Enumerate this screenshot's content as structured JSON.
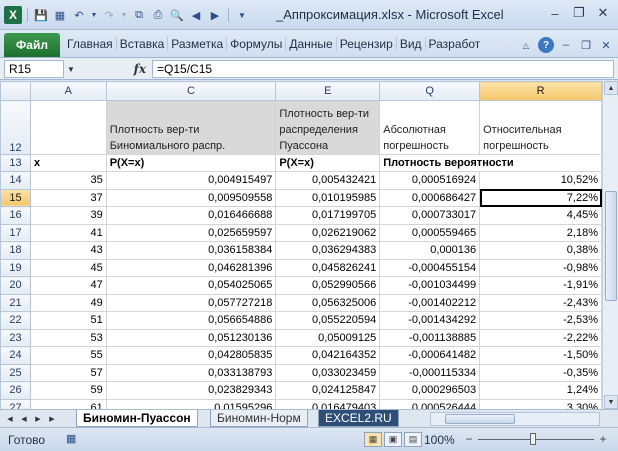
{
  "window": {
    "title": "_Аппроксимация.xlsx - Microsoft Excel"
  },
  "ribbon": {
    "file_tab": "Файл",
    "tabs": [
      "Главная",
      "Вставка",
      "Разметка",
      "Формулы",
      "Данные",
      "Рецензир",
      "Вид",
      "Разработ"
    ]
  },
  "formula_bar": {
    "name_box": "R15",
    "fx_label": "fx",
    "formula": "=Q15/C15"
  },
  "columns": {
    "A": "A",
    "C": "C",
    "E": "E",
    "Q": "Q",
    "R": "R"
  },
  "headers": {
    "row_number": "12",
    "c": "Плотность вер-ти Биномиального распр.",
    "e": "Плотность вер-ти распределения Пуассона",
    "q": "Абсолютная погрешность",
    "r": "Относительная погрешность"
  },
  "subheaders": {
    "row_number": "13",
    "a": "x",
    "c": "P(X=x)",
    "e": "P(X=x)",
    "q": "Плотность вероятности"
  },
  "rows": [
    {
      "n": "14",
      "a": "35",
      "c": "0,004915497",
      "e": "0,005432421",
      "q": "0,000516924",
      "r": "10,52%"
    },
    {
      "n": "15",
      "a": "37",
      "c": "0,009509558",
      "e": "0,010195985",
      "q": "0,000686427",
      "r": "7,22%"
    },
    {
      "n": "16",
      "a": "39",
      "c": "0,016466688",
      "e": "0,017199705",
      "q": "0,000733017",
      "r": "4,45%"
    },
    {
      "n": "17",
      "a": "41",
      "c": "0,025659597",
      "e": "0,026219062",
      "q": "0,000559465",
      "r": "2,18%"
    },
    {
      "n": "18",
      "a": "43",
      "c": "0,036158384",
      "e": "0,036294383",
      "q": "0,000136",
      "r": "0,38%"
    },
    {
      "n": "19",
      "a": "45",
      "c": "0,046281396",
      "e": "0,045826241",
      "q": "-0,000455154",
      "r": "-0,98%"
    },
    {
      "n": "20",
      "a": "47",
      "c": "0,054025065",
      "e": "0,052990566",
      "q": "-0,001034499",
      "r": "-1,91%"
    },
    {
      "n": "21",
      "a": "49",
      "c": "0,057727218",
      "e": "0,056325006",
      "q": "-0,001402212",
      "r": "-2,43%"
    },
    {
      "n": "22",
      "a": "51",
      "c": "0,056654886",
      "e": "0,055220594",
      "q": "-0,001434292",
      "r": "-2,53%"
    },
    {
      "n": "23",
      "a": "53",
      "c": "0,051230136",
      "e": "0,05009125",
      "q": "-0,001138885",
      "r": "-2,22%"
    },
    {
      "n": "24",
      "a": "55",
      "c": "0,042805835",
      "e": "0,042164352",
      "q": "-0,000641482",
      "r": "-1,50%"
    },
    {
      "n": "25",
      "a": "57",
      "c": "0,033138793",
      "e": "0,033023459",
      "q": "-0,000115334",
      "r": "-0,35%"
    },
    {
      "n": "26",
      "a": "59",
      "c": "0,023829343",
      "e": "0,024125847",
      "q": "0,000296503",
      "r": "1,24%"
    },
    {
      "n": "27",
      "a": "61",
      "c": "0,01595296",
      "e": "0,016479403",
      "q": "0,000526444",
      "r": "3,30%"
    }
  ],
  "sheet_tabs": [
    "Биномин-Пуассон",
    "Биномин-Норм",
    "EXCEL2.RU"
  ],
  "status": {
    "ready": "Готово",
    "zoom": "100%"
  }
}
